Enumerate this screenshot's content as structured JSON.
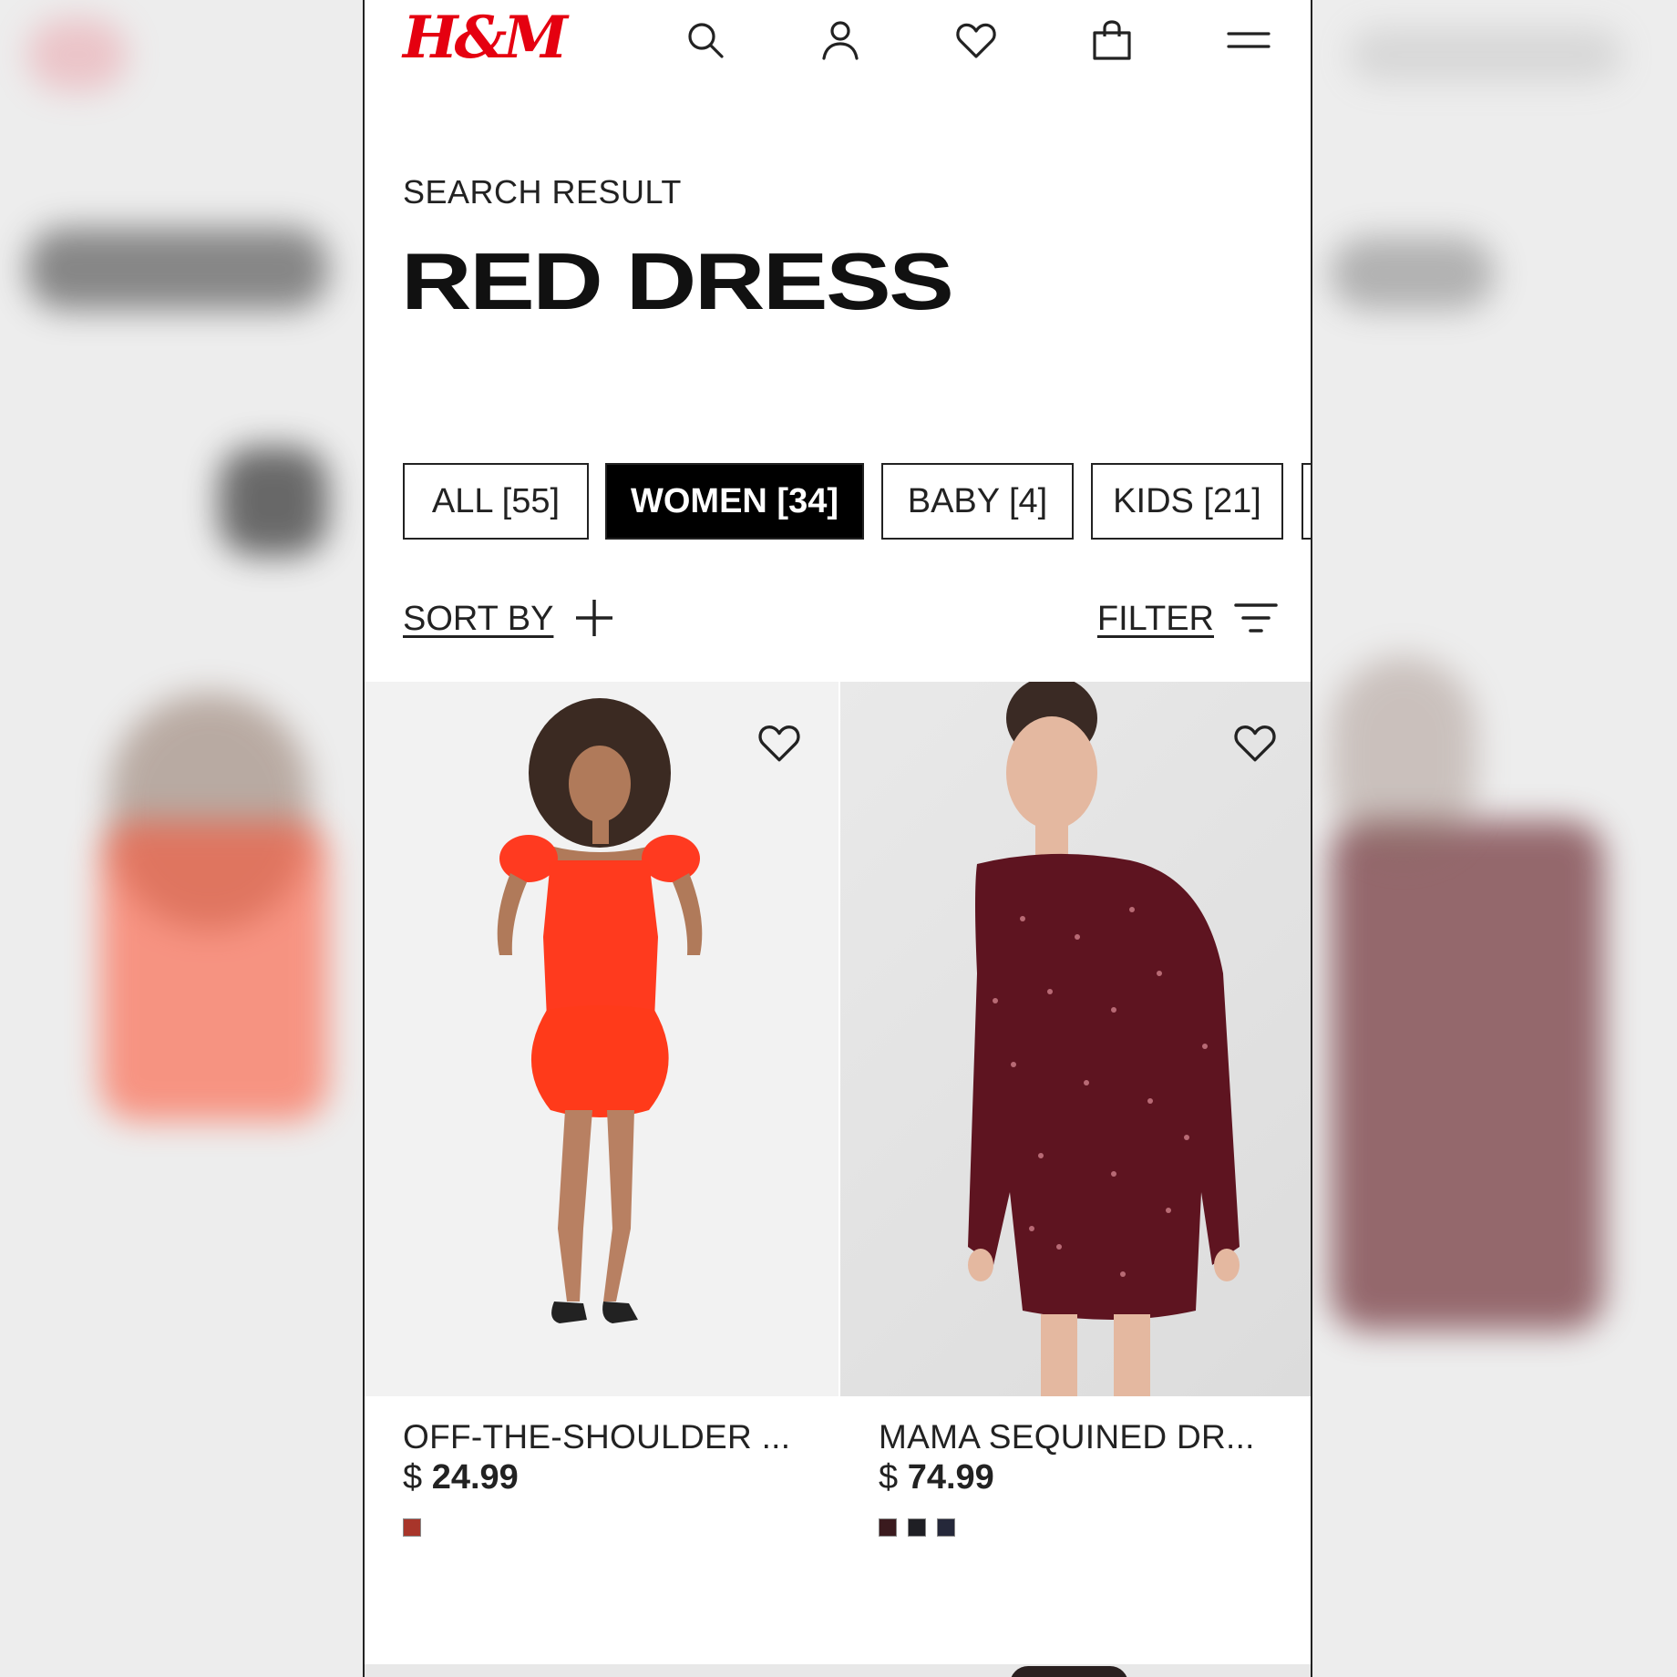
{
  "brand": {
    "logo_text": "H&M",
    "color": "#e50010"
  },
  "header": {
    "icons": [
      "search-icon",
      "account-icon",
      "heart-icon",
      "shopping-bag-icon",
      "menu-icon"
    ]
  },
  "search": {
    "subtitle": "SEARCH RESULT",
    "query_title": "RED DRESS"
  },
  "categories": [
    {
      "label": "ALL [55]",
      "active": false
    },
    {
      "label": "WOMEN [34]",
      "active": true
    },
    {
      "label": "BABY [4]",
      "active": false
    },
    {
      "label": "KIDS [21]",
      "active": false
    }
  ],
  "controls": {
    "sort_label": "SORT BY",
    "filter_label": "FILTER"
  },
  "products": [
    {
      "name": "OFF-THE-SHOULDER ...",
      "currency": "$",
      "price": "24.99",
      "swatches": [
        "#a8352a"
      ]
    },
    {
      "name": "MAMA SEQUINED DR...",
      "currency": "$",
      "price": "74.99",
      "swatches": [
        "#3a1a1e",
        "#1f1f24",
        "#25283a"
      ]
    }
  ]
}
